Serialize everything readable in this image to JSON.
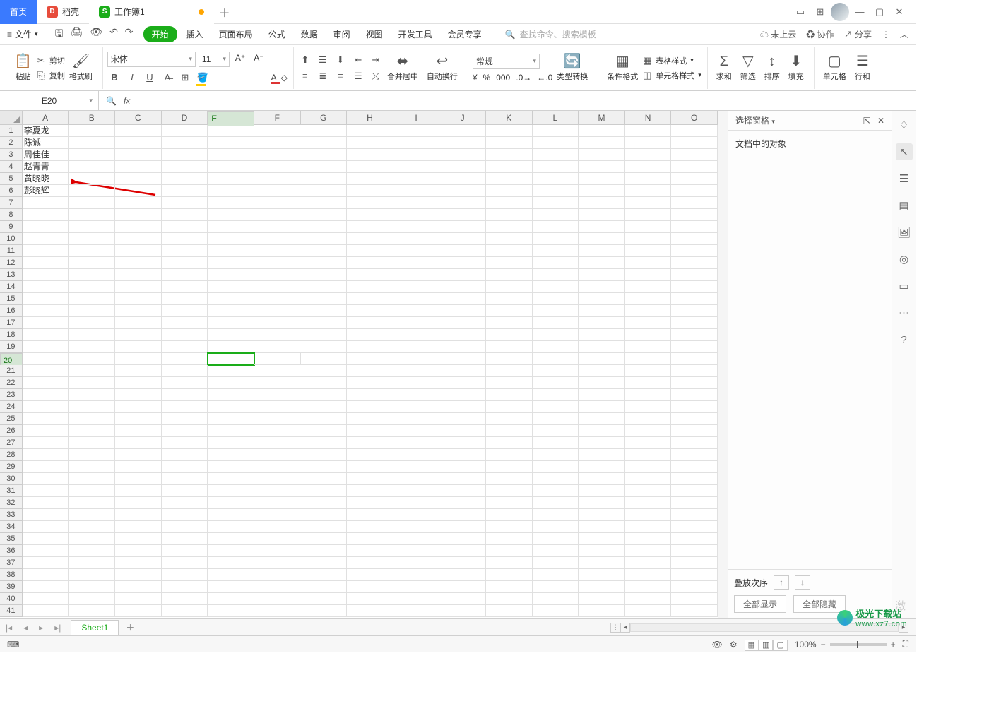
{
  "tabs": {
    "home": "首页",
    "docker": "稻壳",
    "workbook": "工作簿1"
  },
  "menu": {
    "file": "文件",
    "items": [
      "开始",
      "插入",
      "页面布局",
      "公式",
      "数据",
      "审阅",
      "视图",
      "开发工具",
      "会员专享"
    ],
    "search_ph": "查找命令、搜索模板",
    "cloud": "未上云",
    "collab": "协作",
    "share": "分享"
  },
  "ribbon": {
    "paste": "粘贴",
    "cut": "剪切",
    "copy": "复制",
    "format_painter": "格式刷",
    "font_name": "宋体",
    "font_size": "11",
    "merge": "合并居中",
    "wrap": "自动换行",
    "numfmt": "常规",
    "type_convert": "类型转换",
    "cond_fmt": "条件格式",
    "table_style": "表格样式",
    "cell_style": "单元格样式",
    "sum": "求和",
    "filter": "筛选",
    "sort": "排序",
    "fill": "填充",
    "cell": "单元格",
    "rowcol": "行和"
  },
  "namebox": "E20",
  "cols": [
    "A",
    "B",
    "C",
    "D",
    "E",
    "F",
    "G",
    "H",
    "I",
    "J",
    "K",
    "L",
    "M",
    "N",
    "O"
  ],
  "data": {
    "A1": "李夏龙",
    "A2": "陈诚",
    "A3": "周佳佳",
    "A4": "赵青青",
    "A5": "黄晓晓",
    "A6": "彭晓辉"
  },
  "selected": {
    "col": "E",
    "row": 20
  },
  "pane": {
    "title": "选择窗格",
    "label": "文档中的对象",
    "order": "叠放次序",
    "show_all": "全部显示",
    "hide_all": "全部隐藏"
  },
  "sheet": "Sheet1",
  "zoom": "100%",
  "watermark": {
    "name": "极光下载站",
    "url": "www.xz7.com"
  },
  "activate": "激"
}
